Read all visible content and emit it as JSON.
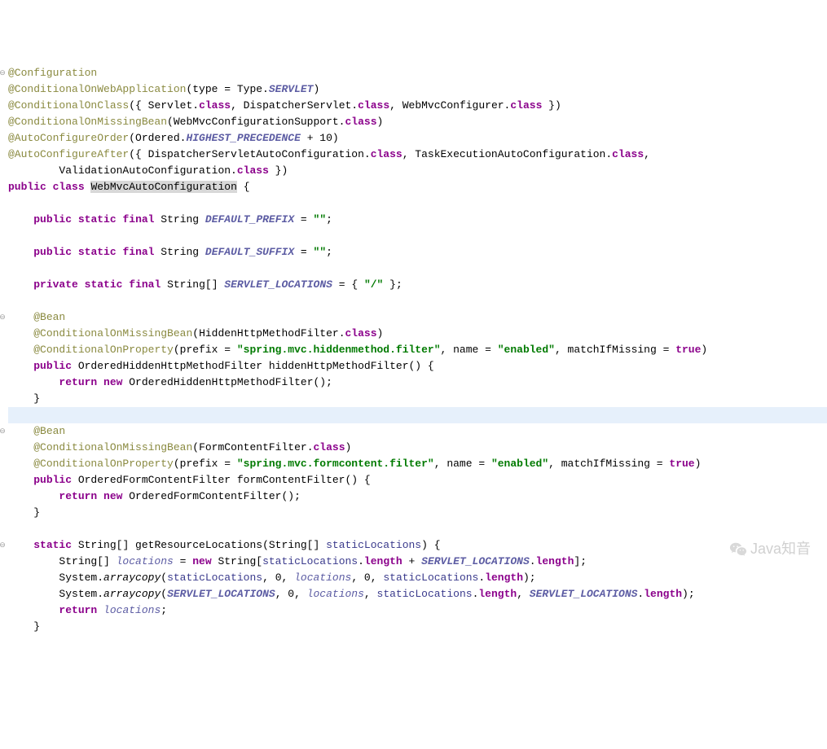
{
  "watermark": "Java知音",
  "fold_glyph": "⊖",
  "lines": [
    {
      "fold": true,
      "hl": false,
      "tokens": [
        [
          "ann",
          "@Configuration"
        ]
      ]
    },
    {
      "fold": false,
      "hl": false,
      "tokens": [
        [
          "ann",
          "@ConditionalOnWebApplication"
        ],
        [
          "",
          "(type = Type."
        ],
        [
          "typeconst",
          "SERVLET"
        ],
        [
          "",
          ")"
        ]
      ]
    },
    {
      "fold": false,
      "hl": false,
      "tokens": [
        [
          "ann",
          "@ConditionalOnClass"
        ],
        [
          "",
          "({ Servlet."
        ],
        [
          "classref",
          "class"
        ],
        [
          "",
          ", DispatcherServlet."
        ],
        [
          "classref",
          "class"
        ],
        [
          "",
          ", WebMvcConfigurer."
        ],
        [
          "classref",
          "class"
        ],
        [
          "",
          " })"
        ]
      ]
    },
    {
      "fold": false,
      "hl": false,
      "tokens": [
        [
          "ann",
          "@ConditionalOnMissingBean"
        ],
        [
          "",
          "(WebMvcConfigurationSupport."
        ],
        [
          "classref",
          "class"
        ],
        [
          "",
          ")"
        ]
      ]
    },
    {
      "fold": false,
      "hl": false,
      "tokens": [
        [
          "ann",
          "@AutoConfigureOrder"
        ],
        [
          "",
          "(Ordered."
        ],
        [
          "typeconst",
          "HIGHEST_PRECEDENCE"
        ],
        [
          "",
          " + 10)"
        ]
      ]
    },
    {
      "fold": false,
      "hl": false,
      "tokens": [
        [
          "ann",
          "@AutoConfigureAfter"
        ],
        [
          "",
          "({ DispatcherServletAutoConfiguration."
        ],
        [
          "classref",
          "class"
        ],
        [
          "",
          ", TaskExecutionAutoConfiguration."
        ],
        [
          "classref",
          "class"
        ],
        [
          "",
          ","
        ]
      ]
    },
    {
      "fold": false,
      "hl": false,
      "tokens": [
        [
          "",
          "        ValidationAutoConfiguration."
        ],
        [
          "classref",
          "class"
        ],
        [
          "",
          " })"
        ]
      ]
    },
    {
      "fold": false,
      "hl": false,
      "tokens": [
        [
          "kw",
          "public"
        ],
        [
          "",
          " "
        ],
        [
          "kw",
          "class"
        ],
        [
          "",
          " "
        ],
        [
          "sel",
          "WebMvcAutoConfiguration"
        ],
        [
          "",
          " {"
        ]
      ]
    },
    {
      "fold": false,
      "hl": false,
      "tokens": [
        [
          "",
          ""
        ]
      ]
    },
    {
      "fold": false,
      "hl": false,
      "tokens": [
        [
          "",
          "    "
        ],
        [
          "kw",
          "public"
        ],
        [
          "",
          " "
        ],
        [
          "kw",
          "static"
        ],
        [
          "",
          " "
        ],
        [
          "kw",
          "final"
        ],
        [
          "",
          " String "
        ],
        [
          "fieldconst",
          "DEFAULT_PREFIX"
        ],
        [
          "",
          " = "
        ],
        [
          "str",
          "\"\""
        ],
        [
          "",
          ";"
        ]
      ]
    },
    {
      "fold": false,
      "hl": false,
      "tokens": [
        [
          "",
          ""
        ]
      ]
    },
    {
      "fold": false,
      "hl": false,
      "tokens": [
        [
          "",
          "    "
        ],
        [
          "kw",
          "public"
        ],
        [
          "",
          " "
        ],
        [
          "kw",
          "static"
        ],
        [
          "",
          " "
        ],
        [
          "kw",
          "final"
        ],
        [
          "",
          " String "
        ],
        [
          "fieldconst",
          "DEFAULT_SUFFIX"
        ],
        [
          "",
          " = "
        ],
        [
          "str",
          "\"\""
        ],
        [
          "",
          ";"
        ]
      ]
    },
    {
      "fold": false,
      "hl": false,
      "tokens": [
        [
          "",
          ""
        ]
      ]
    },
    {
      "fold": false,
      "hl": false,
      "tokens": [
        [
          "",
          "    "
        ],
        [
          "kw",
          "private"
        ],
        [
          "",
          " "
        ],
        [
          "kw",
          "static"
        ],
        [
          "",
          " "
        ],
        [
          "kw",
          "final"
        ],
        [
          "",
          " String[] "
        ],
        [
          "fieldconst",
          "SERVLET_LOCATIONS"
        ],
        [
          "",
          " = { "
        ],
        [
          "str",
          "\"/\""
        ],
        [
          "",
          " };"
        ]
      ]
    },
    {
      "fold": false,
      "hl": false,
      "tokens": [
        [
          "",
          ""
        ]
      ]
    },
    {
      "fold": true,
      "hl": false,
      "tokens": [
        [
          "",
          "    "
        ],
        [
          "ann",
          "@Bean"
        ]
      ]
    },
    {
      "fold": false,
      "hl": false,
      "tokens": [
        [
          "",
          "    "
        ],
        [
          "ann",
          "@ConditionalOnMissingBean"
        ],
        [
          "",
          "(HiddenHttpMethodFilter."
        ],
        [
          "classref",
          "class"
        ],
        [
          "",
          ")"
        ]
      ]
    },
    {
      "fold": false,
      "hl": false,
      "tokens": [
        [
          "",
          "    "
        ],
        [
          "ann",
          "@ConditionalOnProperty"
        ],
        [
          "",
          "(prefix = "
        ],
        [
          "str",
          "\"spring.mvc.hiddenmethod.filter\""
        ],
        [
          "",
          ", name = "
        ],
        [
          "str",
          "\"enabled\""
        ],
        [
          "",
          ", matchIfMissing = "
        ],
        [
          "kw",
          "true"
        ],
        [
          "",
          ")"
        ]
      ]
    },
    {
      "fold": false,
      "hl": false,
      "tokens": [
        [
          "",
          "    "
        ],
        [
          "kw",
          "public"
        ],
        [
          "",
          " OrderedHiddenHttpMethodFilter hiddenHttpMethodFilter() {"
        ]
      ]
    },
    {
      "fold": false,
      "hl": false,
      "tokens": [
        [
          "",
          "        "
        ],
        [
          "kw",
          "return"
        ],
        [
          "",
          " "
        ],
        [
          "kw",
          "new"
        ],
        [
          "",
          " OrderedHiddenHttpMethodFilter();"
        ]
      ]
    },
    {
      "fold": false,
      "hl": false,
      "tokens": [
        [
          "",
          "    }"
        ]
      ]
    },
    {
      "fold": false,
      "hl": true,
      "tokens": [
        [
          "",
          ""
        ]
      ]
    },
    {
      "fold": true,
      "hl": false,
      "tokens": [
        [
          "",
          "    "
        ],
        [
          "ann",
          "@Bean"
        ]
      ]
    },
    {
      "fold": false,
      "hl": false,
      "tokens": [
        [
          "",
          "    "
        ],
        [
          "ann",
          "@ConditionalOnMissingBean"
        ],
        [
          "",
          "(FormContentFilter."
        ],
        [
          "classref",
          "class"
        ],
        [
          "",
          ")"
        ]
      ]
    },
    {
      "fold": false,
      "hl": false,
      "tokens": [
        [
          "",
          "    "
        ],
        [
          "ann",
          "@ConditionalOnProperty"
        ],
        [
          "",
          "(prefix = "
        ],
        [
          "str",
          "\"spring.mvc.formcontent.filter\""
        ],
        [
          "",
          ", name = "
        ],
        [
          "str",
          "\"enabled\""
        ],
        [
          "",
          ", matchIfMissing = "
        ],
        [
          "kw",
          "true"
        ],
        [
          "",
          ")"
        ]
      ]
    },
    {
      "fold": false,
      "hl": false,
      "tokens": [
        [
          "",
          "    "
        ],
        [
          "kw",
          "public"
        ],
        [
          "",
          " OrderedFormContentFilter formContentFilter() {"
        ]
      ]
    },
    {
      "fold": false,
      "hl": false,
      "tokens": [
        [
          "",
          "        "
        ],
        [
          "kw",
          "return"
        ],
        [
          "",
          " "
        ],
        [
          "kw",
          "new"
        ],
        [
          "",
          " OrderedFormContentFilter();"
        ]
      ]
    },
    {
      "fold": false,
      "hl": false,
      "tokens": [
        [
          "",
          "    }"
        ]
      ]
    },
    {
      "fold": false,
      "hl": false,
      "tokens": [
        [
          "",
          ""
        ]
      ]
    },
    {
      "fold": true,
      "hl": false,
      "tokens": [
        [
          "",
          "    "
        ],
        [
          "kw",
          "static"
        ],
        [
          "",
          " String[] getResourceLocations(String[] "
        ],
        [
          "param",
          "staticLocations"
        ],
        [
          "",
          ") {"
        ]
      ]
    },
    {
      "fold": false,
      "hl": false,
      "tokens": [
        [
          "",
          "        String[] "
        ],
        [
          "varitalic",
          "locations"
        ],
        [
          "",
          " = "
        ],
        [
          "kw",
          "new"
        ],
        [
          "",
          " String["
        ],
        [
          "param",
          "staticLocations"
        ],
        [
          "",
          "."
        ],
        [
          "prop",
          "length"
        ],
        [
          "",
          " + "
        ],
        [
          "fieldconst",
          "SERVLET_LOCATIONS"
        ],
        [
          "",
          "."
        ],
        [
          "prop",
          "length"
        ],
        [
          "",
          "];"
        ]
      ]
    },
    {
      "fold": false,
      "hl": false,
      "tokens": [
        [
          "",
          "        System."
        ],
        [
          "methoditalic",
          "arraycopy"
        ],
        [
          "",
          "("
        ],
        [
          "param",
          "staticLocations"
        ],
        [
          "",
          ", 0, "
        ],
        [
          "varitalic",
          "locations"
        ],
        [
          "",
          ", 0, "
        ],
        [
          "param",
          "staticLocations"
        ],
        [
          "",
          "."
        ],
        [
          "prop",
          "length"
        ],
        [
          "",
          ");"
        ]
      ]
    },
    {
      "fold": false,
      "hl": false,
      "tokens": [
        [
          "",
          "        System."
        ],
        [
          "methoditalic",
          "arraycopy"
        ],
        [
          "",
          "("
        ],
        [
          "fieldconst",
          "SERVLET_LOCATIONS"
        ],
        [
          "",
          ", 0, "
        ],
        [
          "varitalic",
          "locations"
        ],
        [
          "",
          ", "
        ],
        [
          "param",
          "staticLocations"
        ],
        [
          "",
          "."
        ],
        [
          "prop",
          "length"
        ],
        [
          "",
          ", "
        ],
        [
          "fieldconst",
          "SERVLET_LOCATIONS"
        ],
        [
          "",
          "."
        ],
        [
          "prop",
          "length"
        ],
        [
          "",
          ");"
        ]
      ]
    },
    {
      "fold": false,
      "hl": false,
      "tokens": [
        [
          "",
          "        "
        ],
        [
          "kw",
          "return"
        ],
        [
          "",
          " "
        ],
        [
          "varitalic",
          "locations"
        ],
        [
          "",
          ";"
        ]
      ]
    },
    {
      "fold": false,
      "hl": false,
      "tokens": [
        [
          "",
          "    }"
        ]
      ]
    }
  ]
}
